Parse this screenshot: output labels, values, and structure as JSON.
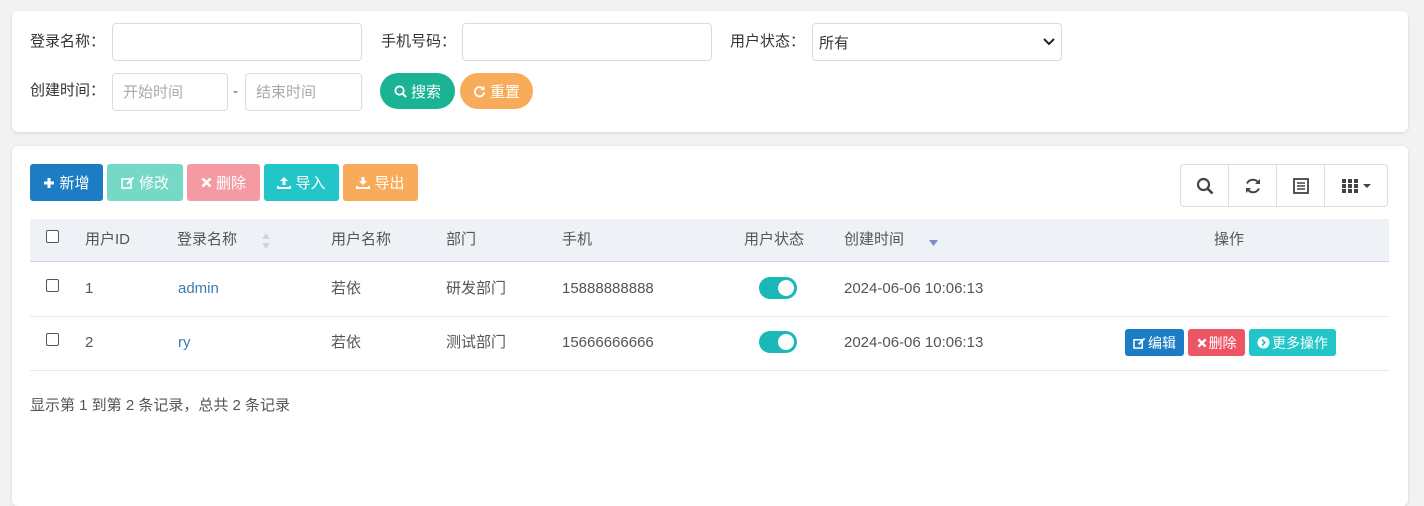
{
  "search": {
    "login_name_label": "登录名称：",
    "phone_label": "手机号码：",
    "status_label": "用户状态：",
    "status_value": "所有",
    "created_label": "创建时间：",
    "start_placeholder": "开始时间",
    "end_placeholder": "结束时间",
    "dash": "-",
    "search_btn": "搜索",
    "reset_btn": "重置"
  },
  "toolbar": {
    "add": "新增",
    "edit": "修改",
    "delete": "删除",
    "import": "导入",
    "export": "导出"
  },
  "colors": {
    "primary": "#1c7cc4",
    "success": "#1ab394",
    "warning": "#f8ac59",
    "danger": "#ed5565",
    "info": "#23c6c8"
  },
  "table": {
    "headers": {
      "user_id": "用户ID",
      "login_name": "登录名称",
      "user_name": "用户名称",
      "dept": "部门",
      "phone": "手机",
      "status": "用户状态",
      "created": "创建时间",
      "actions": "操作"
    },
    "rows": [
      {
        "id": "1",
        "login": "admin",
        "name": "若依",
        "dept": "研发部门",
        "phone": "15888888888",
        "status_on": true,
        "created": "2024-06-06 10:06:13"
      },
      {
        "id": "2",
        "login": "ry",
        "name": "若依",
        "dept": "测试部门",
        "phone": "15666666666",
        "status_on": true,
        "created": "2024-06-06 10:06:13"
      }
    ],
    "row_actions": {
      "edit": "编辑",
      "delete": "删除",
      "more": "更多操作"
    },
    "summary": "显示第 1 到第 2 条记录，总共 2 条记录"
  }
}
